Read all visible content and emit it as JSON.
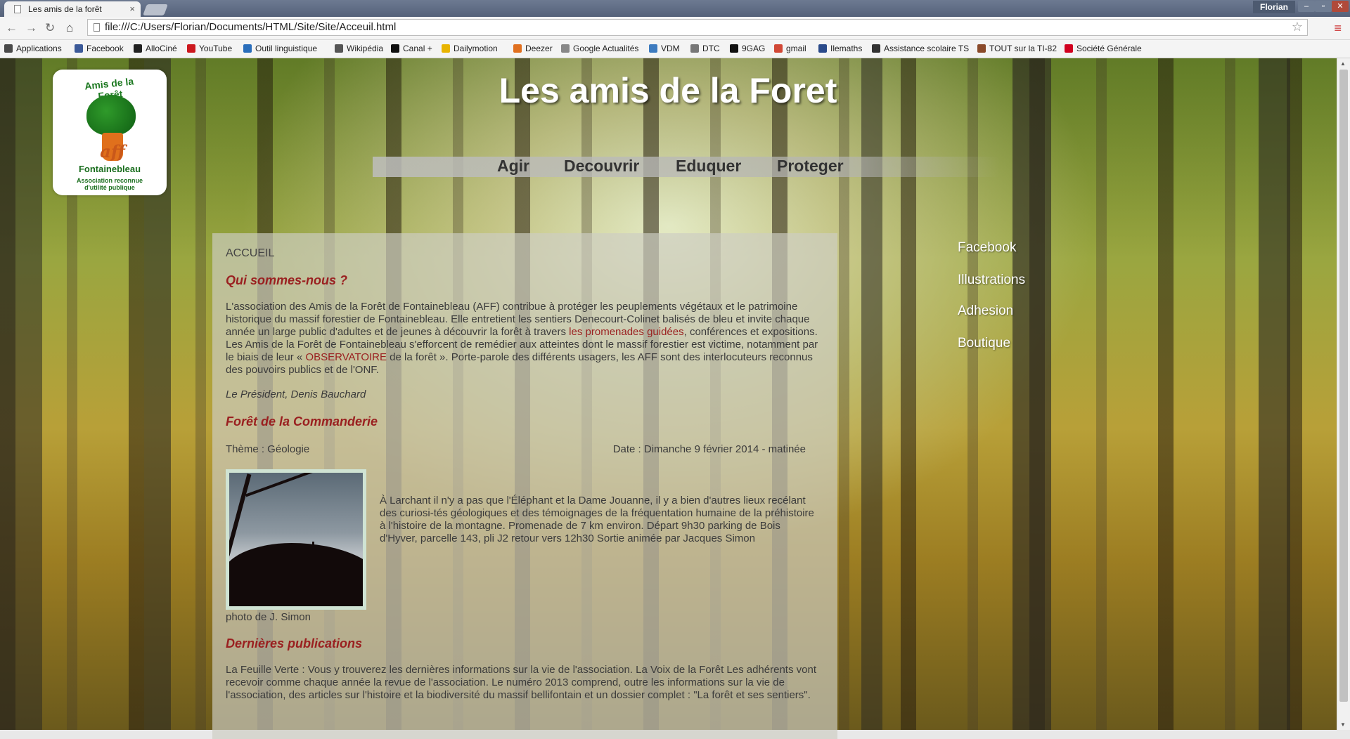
{
  "browser": {
    "tab_title": "Les amis de la forêt",
    "tab_close": "×",
    "user": "Florian",
    "win_min": "‒",
    "win_max": "▫",
    "win_close": "✕",
    "url": "file:///C:/Users/Florian/Documents/HTML/Site/Site/Acceuil.html",
    "nav_back": "←",
    "nav_forward": "→",
    "nav_reload": "↻",
    "nav_home": "⌂",
    "star": "☆",
    "menu": "≡"
  },
  "bookmarks": [
    {
      "label": "Applications",
      "color": "#4a4a4a"
    },
    {
      "label": "Facebook",
      "color": "#3b5998"
    },
    {
      "label": "AlloCiné",
      "color": "#222222"
    },
    {
      "label": "YouTube",
      "color": "#cc181e"
    },
    {
      "label": "Outil linguistique",
      "color": "#2a6ebb"
    },
    {
      "label": "Wikipédia",
      "color": "#555555"
    },
    {
      "label": "Canal +",
      "color": "#111111"
    },
    {
      "label": "Dailymotion",
      "color": "#e8b400"
    },
    {
      "label": "Deezer",
      "color": "#e07020"
    },
    {
      "label": "Google Actualités",
      "color": "#888888"
    },
    {
      "label": "VDM",
      "color": "#3d7bbf"
    },
    {
      "label": "DTC",
      "color": "#777777"
    },
    {
      "label": "9GAG",
      "color": "#111111"
    },
    {
      "label": "gmail",
      "color": "#d14836"
    },
    {
      "label": "Ilemaths",
      "color": "#2a4a8a"
    },
    {
      "label": "Assistance scolaire TS",
      "color": "#333333"
    },
    {
      "label": "TOUT sur la TI-82",
      "color": "#8a4a2a"
    },
    {
      "label": "Société Générale",
      "color": "#d1001f"
    }
  ],
  "logo": {
    "arc_text": "Amis de la Forêt",
    "letters": "aff",
    "city": "Fontainebleau",
    "sub1": "Association reconnue",
    "sub2": "d'utilité publique"
  },
  "site": {
    "title": "Les amis de la Foret",
    "nav": [
      "Agir",
      "Decouvrir",
      "Eduquer",
      "Proteger"
    ],
    "side_links": [
      "Facebook",
      "Illustrations",
      "Adhesion",
      "Boutique"
    ]
  },
  "content": {
    "crumb": "ACCUEIL",
    "h_who": "Qui sommes-nous ?",
    "who_1": "L'association des Amis de la Forêt de Fontainebleau (AFF) contribue à protéger les peuplements végétaux et le patrimoine historique du massif forestier de Fontainebleau. Elle entretient les sentiers Denecourt-Colinet balisés de bleu et invite chaque année un large public d'adultes et de jeunes à découvrir la forêt à travers ",
    "who_link1": "les promenades guidées",
    "who_2": ", conférences et expositions. Les Amis de la Forêt de Fontainebleau s'efforcent de remédier aux atteintes dont le massif forestier est victime, notamment par le biais de leur « ",
    "who_link2": "OBSERVATOIRE",
    "who_3": " de la forêt ». Porte-parole des différents usagers, les AFF sont des interlocuteurs reconnus des pouvoirs publics et de l'ONF.",
    "signature": "Le Président, Denis Bauchard",
    "h_event": "Forêt de la Commanderie",
    "theme": "Thème : Géologie",
    "date": "Date : Dimanche 9 février 2014 - matinée",
    "event_text": "À Larchant il n'y a pas que l'Éléphant et la Dame Jouanne, il y a bien d'autres lieux recélant des curiosi-tés géologiques et des témoignages de la fréquentation humaine de la préhistoire à l'histoire de la montagne. Promenade de 7 km environ. Départ 9h30 parking de Bois d'Hyver, parcelle 143, pli J2 retour vers 12h30 Sortie animée par Jacques Simon",
    "photo_caption": "photo de J. Simon",
    "h_pubs": "Dernières publications",
    "pubs_text": "La Feuille Verte : Vous y trouverez les dernières informations sur la vie de l'association. La Voix de la Forêt Les adhérents vont recevoir comme chaque année la revue de l'association. Le numéro 2013 comprend, outre les informations sur la vie de l'association, des articles sur l'histoire et la biodiversité du massif bellifontain et un dossier complet : \"La forêt et ses sentiers\"."
  },
  "colors": {
    "heading": "#9a2020",
    "link": "#9a2020",
    "side_link": "#ffffff"
  }
}
